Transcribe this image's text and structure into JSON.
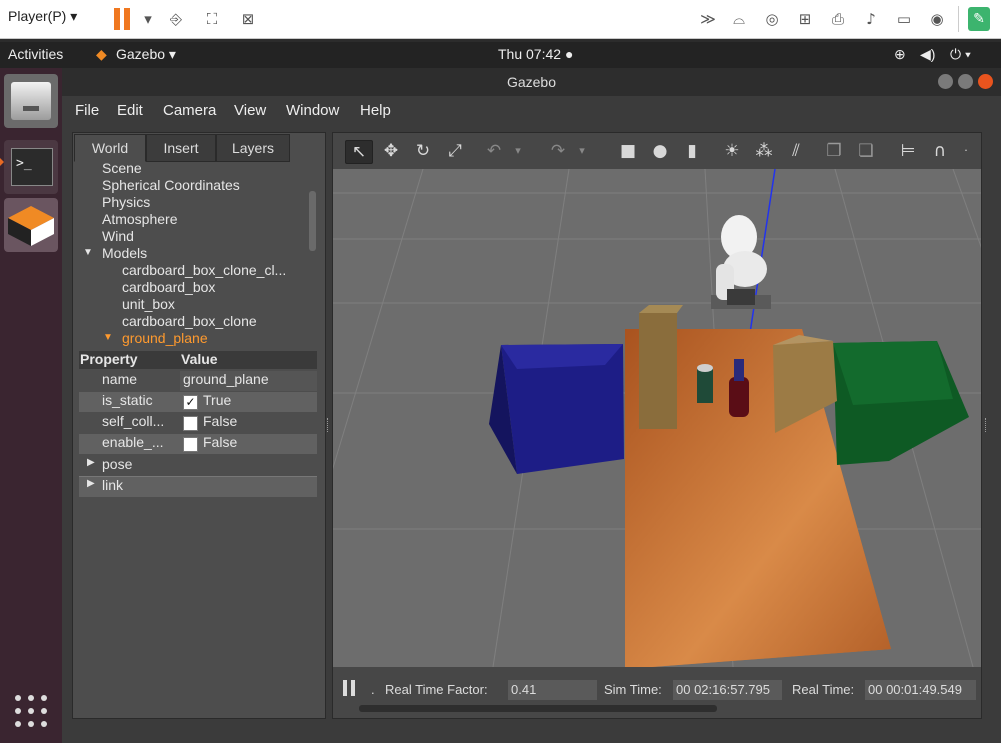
{
  "vmware": {
    "player_menu": "Player(P)",
    "icons": [
      "pause-icon",
      "dropdown-icon",
      "send-ctrl-alt-del-icon",
      "fit-window-icon",
      "unity-icon",
      "more-icon",
      "usb-drive-icon",
      "cd-icon",
      "network-icon",
      "printer-icon",
      "sound-icon",
      "display-icon",
      "record-icon",
      "notes-icon"
    ]
  },
  "topbar": {
    "activities": "Activities",
    "app_menu": "Gazebo ▾",
    "clock": "Thu 07:42 ●",
    "tray_icons": [
      "network-icon",
      "volume-icon",
      "power-icon"
    ]
  },
  "window": {
    "title": "Gazebo",
    "menus": [
      "File",
      "Edit",
      "Camera",
      "View",
      "Window",
      "Help"
    ]
  },
  "left_panel": {
    "tabs": [
      "World",
      "Insert",
      "Layers"
    ],
    "active_tab": "World",
    "tree": {
      "scene": "Scene",
      "spherical": "Spherical Coordinates",
      "physics": "Physics",
      "atmosphere": "Atmosphere",
      "wind": "Wind",
      "models": "Models",
      "model_items": [
        "cardboard_box_clone_cl...",
        "cardboard_box",
        "unit_box",
        "cardboard_box_clone"
      ],
      "selected": "ground_plane"
    },
    "properties": {
      "header_property": "Property",
      "header_value": "Value",
      "name_label": "name",
      "name_value": "ground_plane",
      "is_static_label": "is_static",
      "is_static_value": "True",
      "self_coll_label": "self_coll...",
      "self_coll_value": "False",
      "enable_label": "enable_...",
      "enable_value": "False",
      "pose_label": "pose",
      "link_label": "link"
    }
  },
  "status": {
    "rtf_label": "Real Time Factor:",
    "rtf_value": "0.41",
    "sim_label": "Sim Time:",
    "sim_value": "00 02:16:57.795",
    "real_label": "Real Time:",
    "real_value": "00 00:01:49.549"
  },
  "colors": {
    "accent_orange": "#f07820",
    "selected_text": "#ff9a2e",
    "blue_bin": "#1a1a8c",
    "green_bin": "#0d5a22",
    "table": "#c26a2a"
  }
}
